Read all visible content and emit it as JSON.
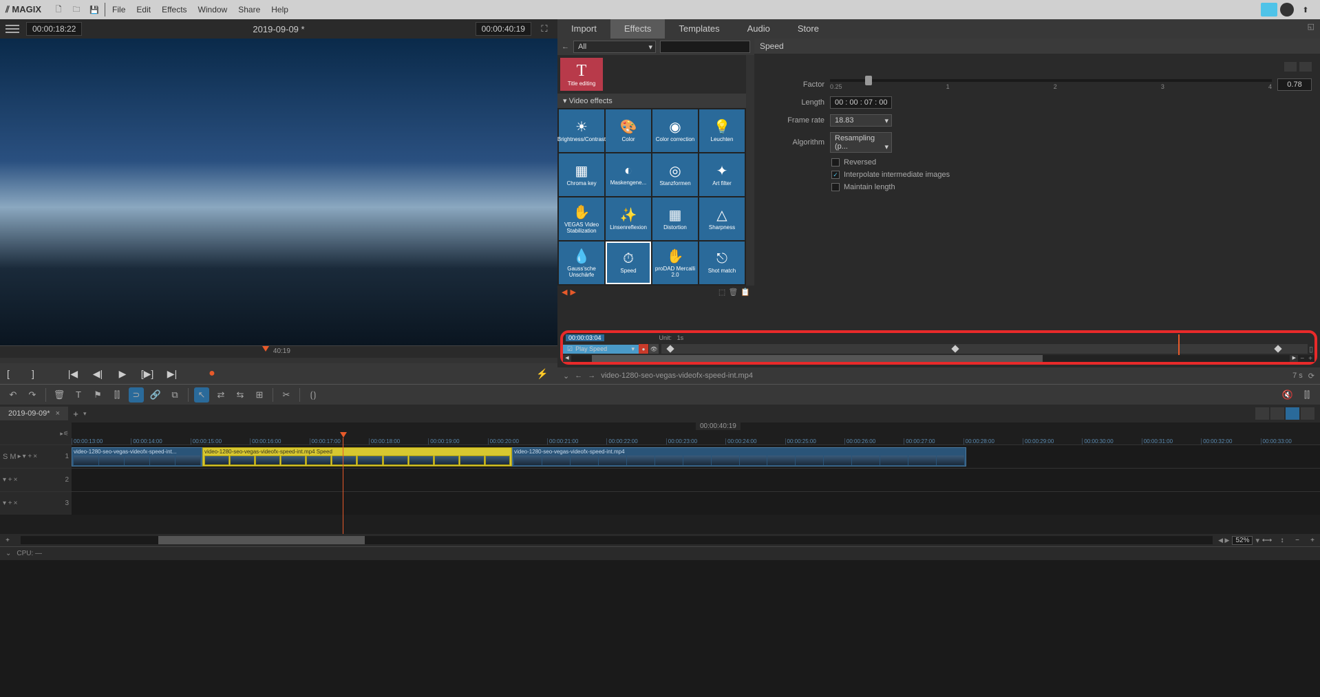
{
  "app": {
    "brand": "MAGIX"
  },
  "menu": [
    "File",
    "Edit",
    "Effects",
    "Window",
    "Share",
    "Help"
  ],
  "preview": {
    "timecode_in": "00:00:18:22",
    "title": "2019-09-09 *",
    "timecode_out": "00:00:40:19",
    "scrub_label": "40:19"
  },
  "tabs": [
    "Import",
    "Effects",
    "Templates",
    "Audio",
    "Store"
  ],
  "effects_nav": {
    "category": "All"
  },
  "title_tile": {
    "label": "Title editing"
  },
  "section": "Video effects",
  "fx": [
    "Brightness/Contrast",
    "Color",
    "Color correction",
    "Leuchten",
    "Chroma key",
    "Maskengene...",
    "Stanzformen",
    "Art filter",
    "VEGAS Video Stabilization",
    "Linsenreflexion",
    "Distortion",
    "Sharpness",
    "Gauss'sche Unschärfe",
    "Speed",
    "proDAD Mercalli 2.0",
    "Shot match"
  ],
  "props": {
    "title": "Speed",
    "factor_label": "Factor",
    "factor_value": "0.78",
    "ticks": [
      "0.25",
      "1",
      "2",
      "3",
      "4"
    ],
    "length_label": "Length",
    "length_value": "00 : 00 : 07 : 00",
    "framerate_label": "Frame rate",
    "framerate_value": "18.83",
    "algorithm_label": "Algorithm",
    "algorithm_value": "Resampling (p...",
    "reversed": "Reversed",
    "interpolate": "Interpolate intermediate images",
    "maintain": "Maintain length"
  },
  "keyframe": {
    "tc": "00:00:03:04",
    "unit_label": "Unit:",
    "unit_value": "1s",
    "param": "Play Speed"
  },
  "file_bar": {
    "name": "video-1280-seo-vegas-videofx-speed-int.mp4",
    "duration": "7 s"
  },
  "project_tab": "2019-09-09*",
  "timeline": {
    "total": "00:00:40:19",
    "ticks": [
      "00:00:13:00",
      "00:00:14:00",
      "00:00:15:00",
      "00:00:16:00",
      "00:00:17:00",
      "00:00:18:00",
      "00:00:19:00",
      "00:00:20:00",
      "00:00:21:00",
      "00:00:22:00",
      "00:00:23:00",
      "00:00:24:00",
      "00:00:25:00",
      "00:00:26:00",
      "00:00:27:00",
      "00:00:28:00",
      "00:00:29:00",
      "00:00:30:00",
      "00:00:31:00",
      "00:00:32:00",
      "00:00:33:00"
    ],
    "sm": "S M",
    "clip1": "video-1280-seo-vegas-videofx-speed-int...",
    "clip2": "video-1280-seo-vegas-videofx-speed-int.mp4   Speed",
    "clip3": "video-1280-seo-vegas-videofx-speed-int.mp4",
    "zoom": "52%"
  },
  "status": {
    "cpu": "CPU: —"
  }
}
